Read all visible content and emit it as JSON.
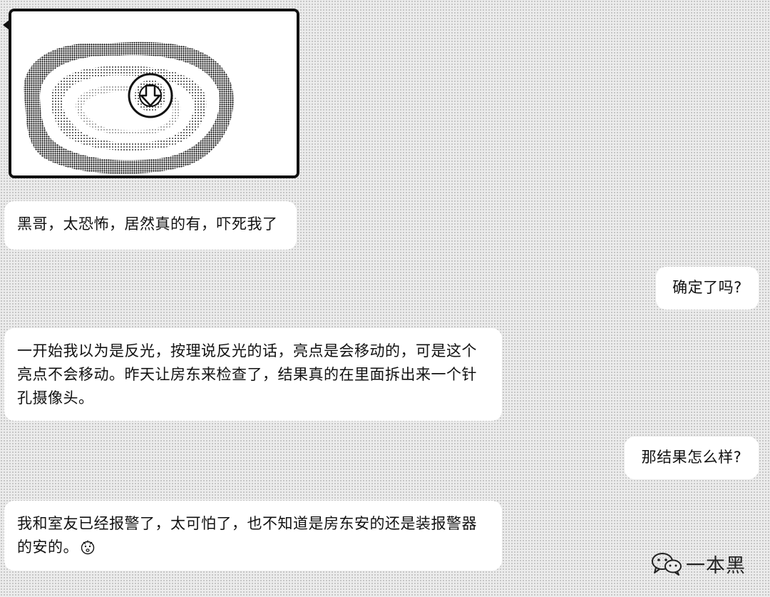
{
  "messages": {
    "m1": "黑哥，太恐怖，居然真的有，吓死我了",
    "m2": "确定了吗?",
    "m3_line1": "一开始我以为是反光，按理说反光的话，亮点是会移动的，可是这个",
    "m3_line2": "亮点不会移动。昨天让房东来检查了，结果真的在里面拆出来一个针",
    "m3_line3": "孔摄像头。",
    "m4": "那结果怎么样?",
    "m5_line1": "我和室友已经报警了，太可怕了，也不知道是房东安的还是装报警器",
    "m5_line2": "的安的。"
  },
  "watermark": {
    "text": "一本黑",
    "icon": "wechat-icon"
  },
  "icons": {
    "emoji": "scared-emoji-icon",
    "image": "camera-lens-photo"
  }
}
